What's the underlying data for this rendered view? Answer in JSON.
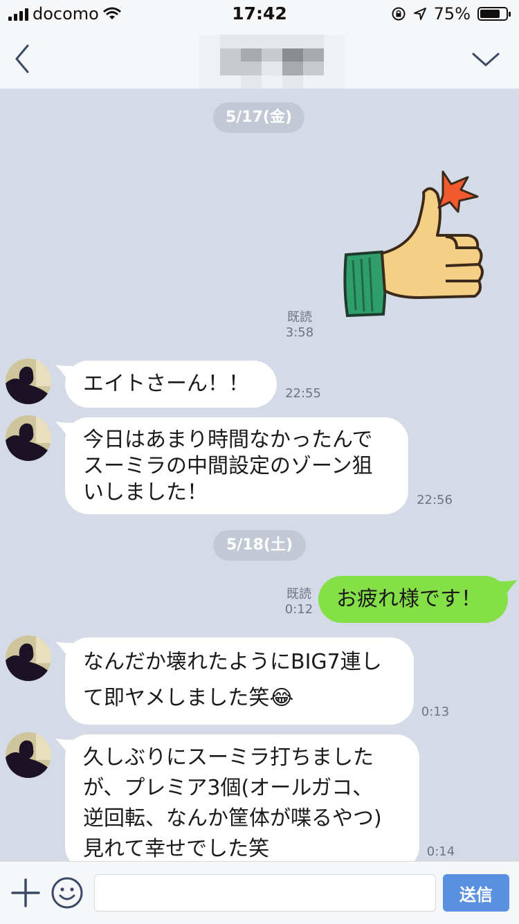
{
  "status_bar": {
    "carrier": "docomo",
    "time": "17:42",
    "battery": "75%",
    "icons": [
      "signal-icon",
      "wifi-icon",
      "rotation-lock-icon",
      "location-icon",
      "battery-icon"
    ]
  },
  "header": {
    "back_icon": "chevron-left-icon",
    "menu_icon": "chevron-down-icon",
    "title_redacted": true
  },
  "messages": {
    "date1": "5/17(金)",
    "sticker": {
      "icon": "thumbs-up-sticker",
      "read": "既読",
      "time": "3:58"
    },
    "m1": {
      "text": "エイトさーん！！",
      "time": "22:55"
    },
    "m2": {
      "lines": [
        "今日はあまり時間なかったんで",
        "スーミラの中間設定のゾーン狙",
        "いしました！"
      ],
      "time": "22:56"
    },
    "date2": "5/18(土)",
    "m3": {
      "text": "お疲れ様です！",
      "read": "既読",
      "time": "0:12"
    },
    "m4": {
      "lines": [
        "なんだか壊れたようにBIG7連し",
        "て即ヤメしました笑"
      ],
      "emoji": "😂",
      "time": "0:13"
    },
    "m5": {
      "lines": [
        "久しぶりにスーミラ打ちました",
        "が、プレミア3個(オールガコ、",
        "逆回転、なんか筐体が喋るやつ)",
        "見れて幸せでした笑"
      ],
      "time": "0:14"
    }
  },
  "input_bar": {
    "placeholder": "",
    "send_label": "送信",
    "icons": [
      "plus-icon",
      "emoji-icon"
    ]
  },
  "colors": {
    "background": "#d5dbe6",
    "my_bubble": "#85e048",
    "their_bubble": "#ffffff",
    "send_button": "#5b8fe0"
  }
}
